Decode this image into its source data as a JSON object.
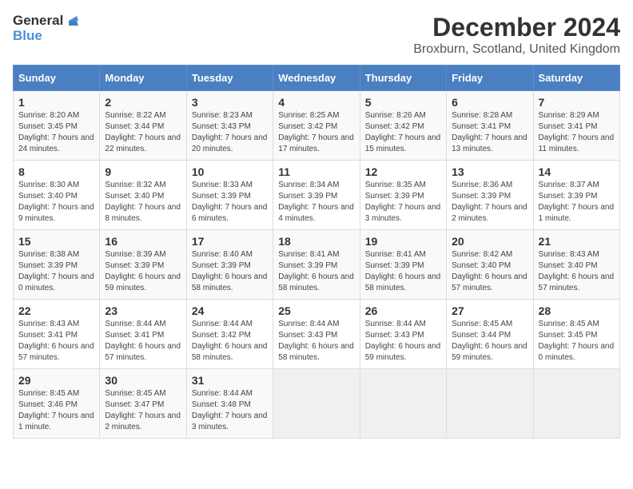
{
  "logo": {
    "text_general": "General",
    "text_blue": "Blue"
  },
  "title": "December 2024",
  "subtitle": "Broxburn, Scotland, United Kingdom",
  "days_of_week": [
    "Sunday",
    "Monday",
    "Tuesday",
    "Wednesday",
    "Thursday",
    "Friday",
    "Saturday"
  ],
  "weeks": [
    [
      {
        "day": 1,
        "info": "Sunrise: 8:20 AM\nSunset: 3:45 PM\nDaylight: 7 hours and 24 minutes."
      },
      {
        "day": 2,
        "info": "Sunrise: 8:22 AM\nSunset: 3:44 PM\nDaylight: 7 hours and 22 minutes."
      },
      {
        "day": 3,
        "info": "Sunrise: 8:23 AM\nSunset: 3:43 PM\nDaylight: 7 hours and 20 minutes."
      },
      {
        "day": 4,
        "info": "Sunrise: 8:25 AM\nSunset: 3:42 PM\nDaylight: 7 hours and 17 minutes."
      },
      {
        "day": 5,
        "info": "Sunrise: 8:26 AM\nSunset: 3:42 PM\nDaylight: 7 hours and 15 minutes."
      },
      {
        "day": 6,
        "info": "Sunrise: 8:28 AM\nSunset: 3:41 PM\nDaylight: 7 hours and 13 minutes."
      },
      {
        "day": 7,
        "info": "Sunrise: 8:29 AM\nSunset: 3:41 PM\nDaylight: 7 hours and 11 minutes."
      }
    ],
    [
      {
        "day": 8,
        "info": "Sunrise: 8:30 AM\nSunset: 3:40 PM\nDaylight: 7 hours and 9 minutes."
      },
      {
        "day": 9,
        "info": "Sunrise: 8:32 AM\nSunset: 3:40 PM\nDaylight: 7 hours and 8 minutes."
      },
      {
        "day": 10,
        "info": "Sunrise: 8:33 AM\nSunset: 3:39 PM\nDaylight: 7 hours and 6 minutes."
      },
      {
        "day": 11,
        "info": "Sunrise: 8:34 AM\nSunset: 3:39 PM\nDaylight: 7 hours and 4 minutes."
      },
      {
        "day": 12,
        "info": "Sunrise: 8:35 AM\nSunset: 3:39 PM\nDaylight: 7 hours and 3 minutes."
      },
      {
        "day": 13,
        "info": "Sunrise: 8:36 AM\nSunset: 3:39 PM\nDaylight: 7 hours and 2 minutes."
      },
      {
        "day": 14,
        "info": "Sunrise: 8:37 AM\nSunset: 3:39 PM\nDaylight: 7 hours and 1 minute."
      }
    ],
    [
      {
        "day": 15,
        "info": "Sunrise: 8:38 AM\nSunset: 3:39 PM\nDaylight: 7 hours and 0 minutes."
      },
      {
        "day": 16,
        "info": "Sunrise: 8:39 AM\nSunset: 3:39 PM\nDaylight: 6 hours and 59 minutes."
      },
      {
        "day": 17,
        "info": "Sunrise: 8:40 AM\nSunset: 3:39 PM\nDaylight: 6 hours and 58 minutes."
      },
      {
        "day": 18,
        "info": "Sunrise: 8:41 AM\nSunset: 3:39 PM\nDaylight: 6 hours and 58 minutes."
      },
      {
        "day": 19,
        "info": "Sunrise: 8:41 AM\nSunset: 3:39 PM\nDaylight: 6 hours and 58 minutes."
      },
      {
        "day": 20,
        "info": "Sunrise: 8:42 AM\nSunset: 3:40 PM\nDaylight: 6 hours and 57 minutes."
      },
      {
        "day": 21,
        "info": "Sunrise: 8:43 AM\nSunset: 3:40 PM\nDaylight: 6 hours and 57 minutes."
      }
    ],
    [
      {
        "day": 22,
        "info": "Sunrise: 8:43 AM\nSunset: 3:41 PM\nDaylight: 6 hours and 57 minutes."
      },
      {
        "day": 23,
        "info": "Sunrise: 8:44 AM\nSunset: 3:41 PM\nDaylight: 6 hours and 57 minutes."
      },
      {
        "day": 24,
        "info": "Sunrise: 8:44 AM\nSunset: 3:42 PM\nDaylight: 6 hours and 58 minutes."
      },
      {
        "day": 25,
        "info": "Sunrise: 8:44 AM\nSunset: 3:43 PM\nDaylight: 6 hours and 58 minutes."
      },
      {
        "day": 26,
        "info": "Sunrise: 8:44 AM\nSunset: 3:43 PM\nDaylight: 6 hours and 59 minutes."
      },
      {
        "day": 27,
        "info": "Sunrise: 8:45 AM\nSunset: 3:44 PM\nDaylight: 6 hours and 59 minutes."
      },
      {
        "day": 28,
        "info": "Sunrise: 8:45 AM\nSunset: 3:45 PM\nDaylight: 7 hours and 0 minutes."
      }
    ],
    [
      {
        "day": 29,
        "info": "Sunrise: 8:45 AM\nSunset: 3:46 PM\nDaylight: 7 hours and 1 minute."
      },
      {
        "day": 30,
        "info": "Sunrise: 8:45 AM\nSunset: 3:47 PM\nDaylight: 7 hours and 2 minutes."
      },
      {
        "day": 31,
        "info": "Sunrise: 8:44 AM\nSunset: 3:48 PM\nDaylight: 7 hours and 3 minutes."
      },
      null,
      null,
      null,
      null
    ]
  ]
}
